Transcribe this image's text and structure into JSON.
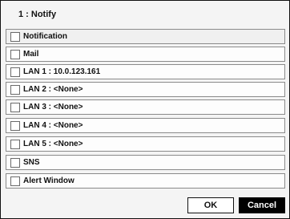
{
  "dialog": {
    "title": "1 : Notify",
    "items": [
      {
        "label": "Notification",
        "checked": false
      },
      {
        "label": "Mail",
        "checked": false
      },
      {
        "label": "LAN 1 : 10.0.123.161",
        "checked": false
      },
      {
        "label": "LAN 2 : <None>",
        "checked": false
      },
      {
        "label": "LAN 3 : <None>",
        "checked": false
      },
      {
        "label": "LAN 4 : <None>",
        "checked": false
      },
      {
        "label": "LAN 5 : <None>",
        "checked": false
      },
      {
        "label": "SNS",
        "checked": false
      },
      {
        "label": "Alert Window",
        "checked": false
      }
    ],
    "buttons": {
      "ok_label": "OK",
      "cancel_label": "Cancel"
    }
  }
}
